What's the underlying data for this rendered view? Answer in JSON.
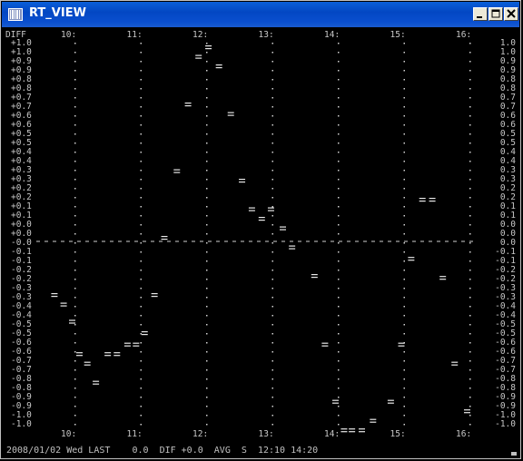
{
  "window": {
    "title": "RT_VIEW",
    "icon": "barcode-app-icon",
    "controls": [
      "minimize-icon",
      "maximize-icon",
      "close-icon"
    ]
  },
  "status": {
    "text": "2008/01/02 Wed LAST    0.0  DIF +0.0  AVG  S  12:10 14:20"
  },
  "chart_data": {
    "type": "scatter",
    "corner_label": "DIFF",
    "x_ticks": [
      "10:",
      "11:",
      "12:",
      "13:",
      "14:",
      "15:",
      "16:"
    ],
    "y_ticks_left": [
      "+1.0",
      "+1.0",
      "+0.9",
      "+0.9",
      "+0.8",
      "+0.8",
      "+0.7",
      "+0.7",
      "+0.6",
      "+0.6",
      "+0.5",
      "+0.5",
      "+0.4",
      "+0.4",
      "+0.3",
      "+0.3",
      "+0.2",
      "+0.2",
      "+0.1",
      "+0.1",
      "+0.0",
      "+0.0",
      "-0.0",
      "-0.1",
      "-0.1",
      "-0.2",
      "-0.2",
      "-0.3",
      "-0.3",
      "-0.4",
      "-0.4",
      "-0.5",
      "-0.5",
      "-0.6",
      "-0.6",
      "-0.7",
      "-0.7",
      "-0.8",
      "-0.8",
      "-0.9",
      "-0.9",
      "-1.0",
      "-1.0"
    ],
    "y_ticks_right": [
      "1.0",
      "1.0",
      "0.9",
      "0.9",
      "0.8",
      "0.8",
      "0.7",
      "0.7",
      "0.6",
      "0.6",
      "0.5",
      "0.5",
      "0.4",
      "0.4",
      "0.3",
      "0.3",
      "0.2",
      "0.2",
      "0.1",
      "0.1",
      "0.0",
      "0.0",
      "0.0",
      "-0.1",
      "-0.1",
      "-0.2",
      "-0.2",
      "-0.3",
      "-0.3",
      "-0.4",
      "-0.4",
      "-0.5",
      "-0.5",
      "-0.6",
      "-0.6",
      "-0.7",
      "-0.7",
      "-0.8",
      "-0.8",
      "-0.9",
      "-0.9",
      "-1.0",
      "-1.0"
    ],
    "ylim": [
      1.05,
      -1.05
    ],
    "zero_line": true,
    "points": [
      {
        "x": 9.73,
        "y": -0.3
      },
      {
        "x": 9.87,
        "y": -0.35
      },
      {
        "x": 10.0,
        "y": -0.44
      },
      {
        "x": 10.11,
        "y": -0.61
      },
      {
        "x": 10.23,
        "y": -0.66
      },
      {
        "x": 10.36,
        "y": -0.76
      },
      {
        "x": 10.54,
        "y": -0.61
      },
      {
        "x": 10.68,
        "y": -0.61
      },
      {
        "x": 10.84,
        "y": -0.56
      },
      {
        "x": 10.97,
        "y": -0.56
      },
      {
        "x": 11.1,
        "y": -0.5
      },
      {
        "x": 11.25,
        "y": -0.3
      },
      {
        "x": 11.4,
        "y": 0.0
      },
      {
        "x": 11.59,
        "y": 0.35
      },
      {
        "x": 11.76,
        "y": 0.7
      },
      {
        "x": 11.92,
        "y": 0.95
      },
      {
        "x": 12.07,
        "y": 1.0
      },
      {
        "x": 12.23,
        "y": 0.9
      },
      {
        "x": 12.41,
        "y": 0.65
      },
      {
        "x": 12.58,
        "y": 0.3
      },
      {
        "x": 12.73,
        "y": 0.15
      },
      {
        "x": 12.88,
        "y": 0.1
      },
      {
        "x": 13.02,
        "y": 0.15
      },
      {
        "x": 13.2,
        "y": 0.05
      },
      {
        "x": 13.34,
        "y": -0.05
      },
      {
        "x": 13.68,
        "y": -0.2
      },
      {
        "x": 13.84,
        "y": -0.56
      },
      {
        "x": 14.0,
        "y": -0.86
      },
      {
        "x": 14.13,
        "y": -1.01
      },
      {
        "x": 14.25,
        "y": -1.01
      },
      {
        "x": 14.4,
        "y": -1.01
      },
      {
        "x": 14.57,
        "y": -0.96
      },
      {
        "x": 14.84,
        "y": -0.86
      },
      {
        "x": 15.0,
        "y": -0.56
      },
      {
        "x": 15.15,
        "y": -0.11
      },
      {
        "x": 15.32,
        "y": 0.2
      },
      {
        "x": 15.47,
        "y": 0.2
      },
      {
        "x": 15.63,
        "y": -0.21
      },
      {
        "x": 15.81,
        "y": -0.66
      },
      {
        "x": 16.0,
        "y": -0.91
      }
    ]
  }
}
